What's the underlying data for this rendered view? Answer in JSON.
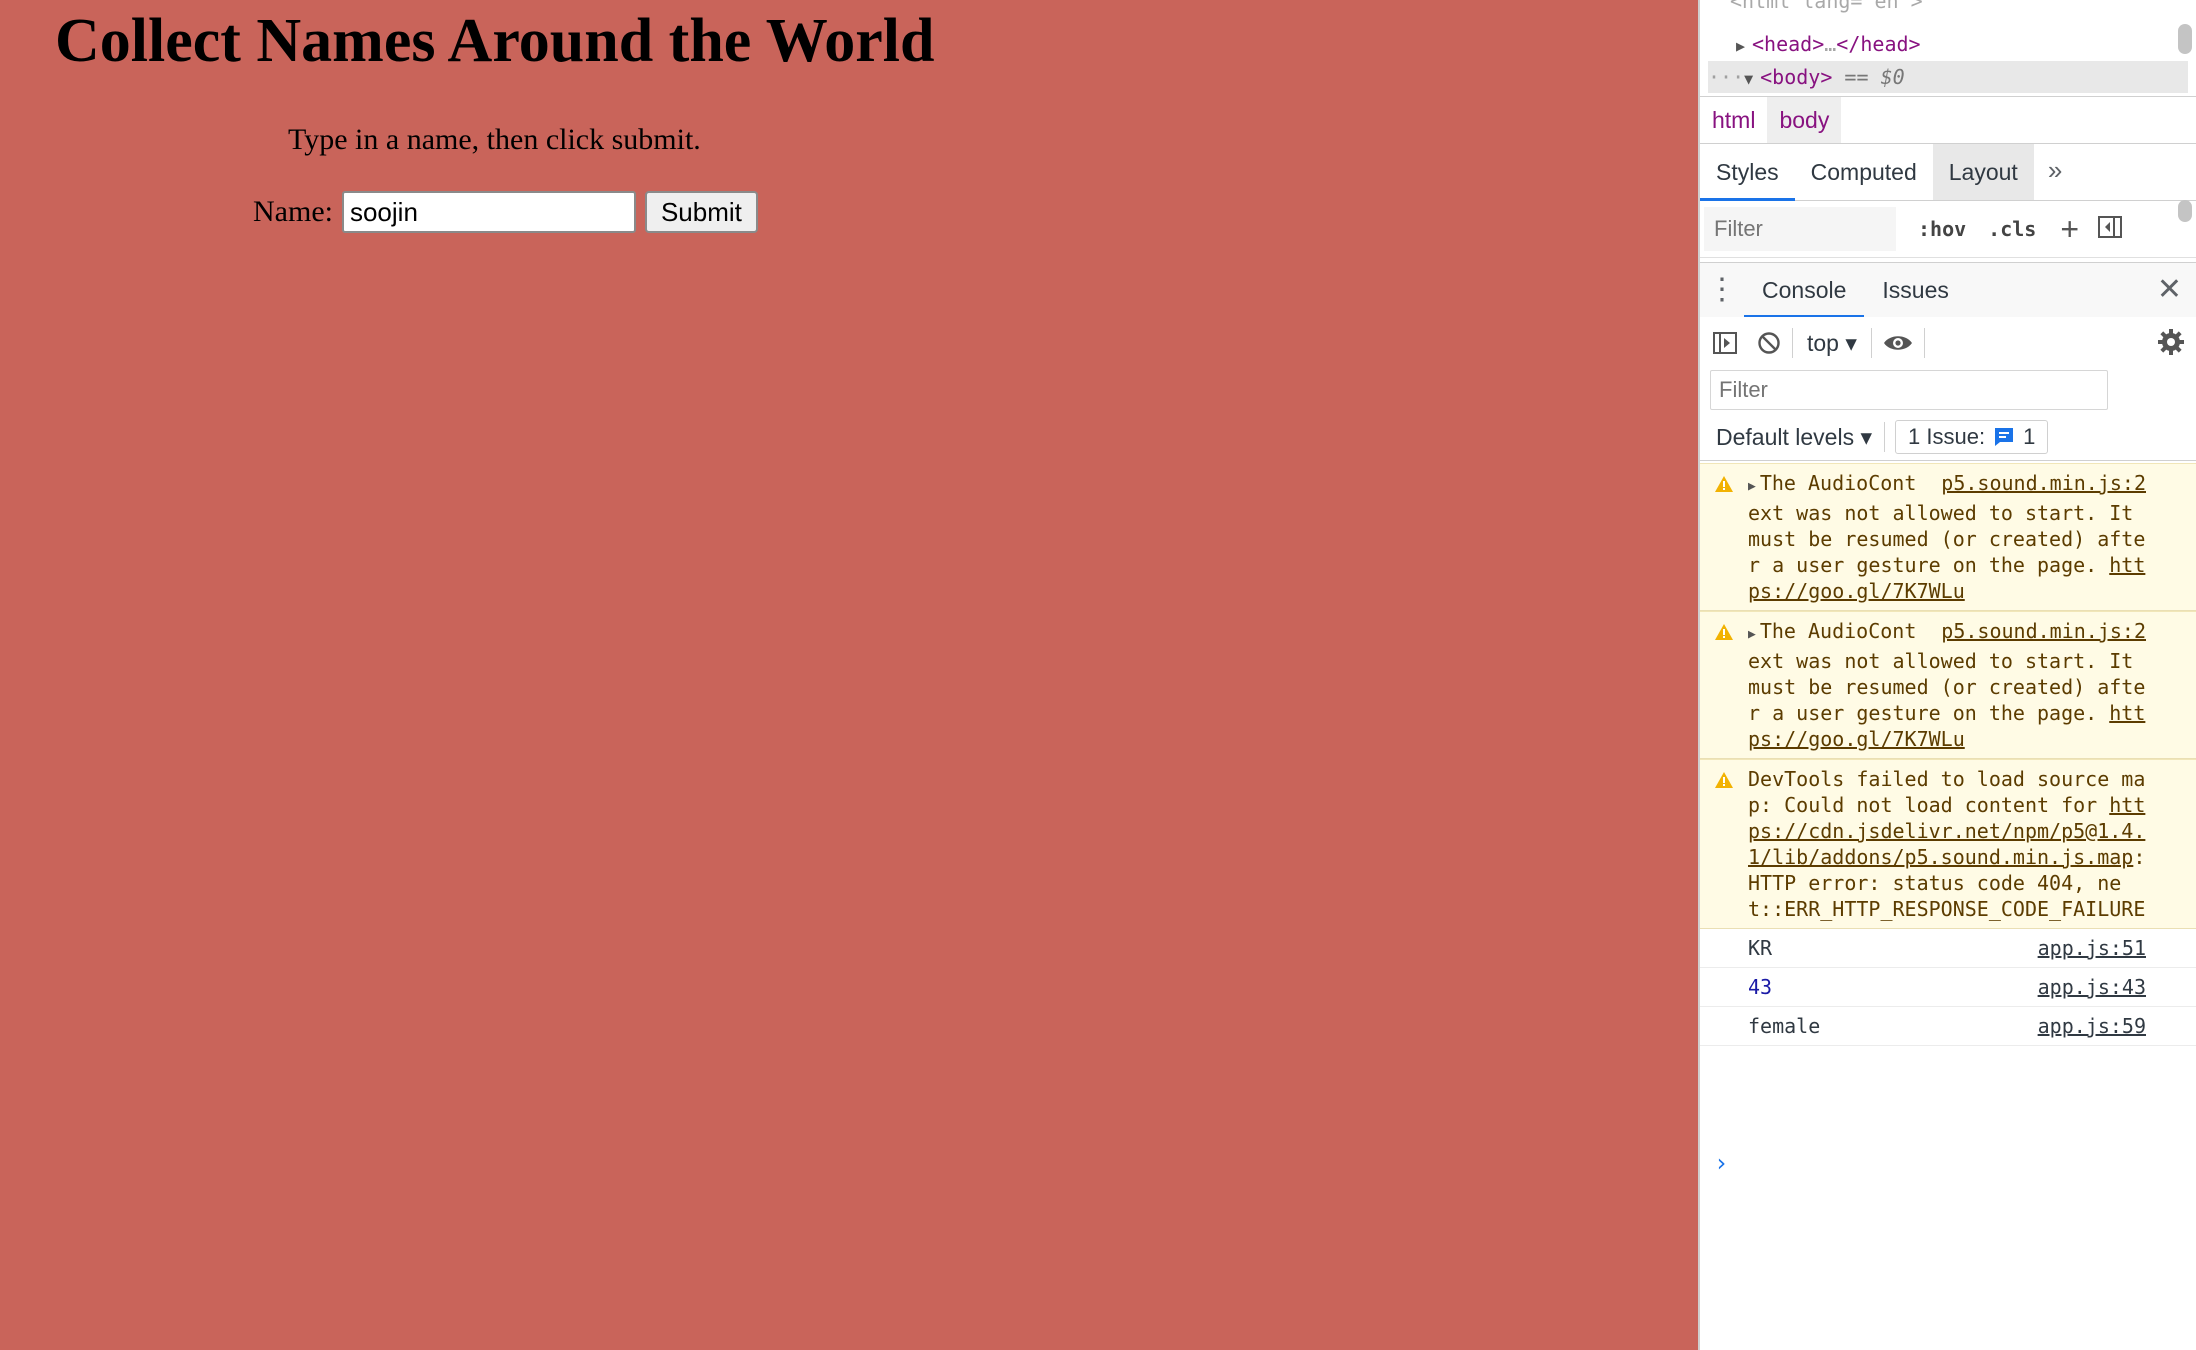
{
  "page": {
    "title": "Collect Names Around the World",
    "instructions": "Type in a name, then click submit.",
    "name_label": "Name:",
    "name_value": "soojin",
    "submit_label": "Submit",
    "background_color": "#c9645a"
  },
  "devtools": {
    "elements": {
      "html_line": "<html lang=\"en\">",
      "head_open": "<head>",
      "head_ellipsis": "…",
      "head_close": "</head>",
      "body_open": "<body>",
      "body_eq": "==",
      "body_ref": "$0"
    },
    "breadcrumb": [
      "html",
      "body"
    ],
    "styles_tabs": [
      "Styles",
      "Computed",
      "Layout"
    ],
    "styles_filter_placeholder": "Filter",
    "hov_label": ":hov",
    "cls_label": ".cls",
    "drawer_tabs": [
      "Console",
      "Issues"
    ],
    "context": "top",
    "console_filter_placeholder": "Filter",
    "levels_label": "Default levels",
    "issues_label": "1 Issue:",
    "issues_count": "1",
    "messages": [
      {
        "type": "warn",
        "source": "p5.sound.min.js:2",
        "text": "The AudioContext was not allowed to start. It must be resumed (or created) after a user gesture on the page. ",
        "link": "https://goo.gl/7K7WLu"
      },
      {
        "type": "warn",
        "source": "p5.sound.min.js:2",
        "text": "The AudioContext was not allowed to start. It must be resumed (or created) after a user gesture on the page. ",
        "link": "https://goo.gl/7K7WLu"
      },
      {
        "type": "warn",
        "text_pre": "DevTools failed to load source map: Could not load content for ",
        "link": "https://cdn.jsdelivr.net/npm/p5@1.4.1/lib/addons/p5.sound.min.js.map",
        "text_post": ": HTTP error: status code 404, net::ERR_HTTP_RESPONSE_CODE_FAILURE"
      },
      {
        "type": "log",
        "value": "KR",
        "source": "app.js:51"
      },
      {
        "type": "log",
        "value": "43",
        "source": "app.js:43"
      },
      {
        "type": "log",
        "value": "female",
        "source": "app.js:59"
      }
    ],
    "prompt": "›"
  }
}
